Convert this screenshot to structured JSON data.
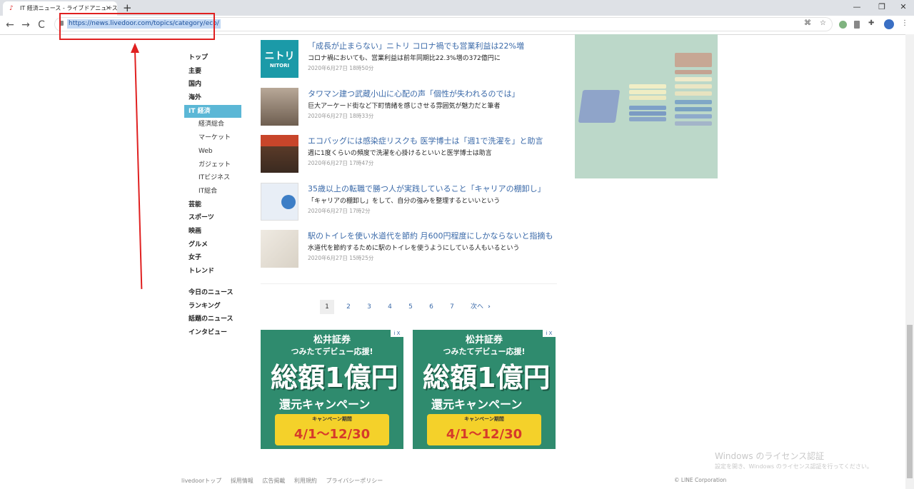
{
  "browser": {
    "tab_title": "IT 経済ニュース - ライブドアニュース",
    "tab_close": "×",
    "new_tab": "+",
    "url": "https://news.livedoor.com/topics/category/eco/",
    "back": "←",
    "forward": "→",
    "reload": "C",
    "menu": "⋮",
    "minimize": "—",
    "maximize": "❐",
    "close": "✕"
  },
  "nav": {
    "items": [
      "トップ",
      "主要",
      "国内",
      "海外"
    ],
    "active": "IT 経済",
    "subitems": [
      "経済総合",
      "マーケット",
      "Web",
      "ガジェット",
      "ITビジネス",
      "IT総合"
    ],
    "items2": [
      "芸能",
      "スポーツ",
      "映画",
      "グルメ",
      "女子",
      "トレンド"
    ],
    "bottom": [
      "今日のニュース",
      "ランキング",
      "話題のニュース",
      "インタビュー"
    ]
  },
  "articles": [
    {
      "title": "「成長が止まらない」ニトリ コロナ禍でも営業利益は22%増",
      "desc": "コロナ禍においても、営業利益は前年同期比22.3%増の372億円に",
      "date": "2020年6月27日 18時50分",
      "thumb_text": "ニトリ",
      "thumb_sub": "NITORI",
      "thumb_color": "#1b9aa8"
    },
    {
      "title": "タワマン建つ武蔵小山に心配の声「個性が失われるのでは」",
      "desc": "巨大アーケード街など下町情緒を感じさせる雰囲気が魅力だと筆者",
      "date": "2020年6月27日 18時33分",
      "thumb_color": "#8a7d6e"
    },
    {
      "title": "エコバッグには感染症リスクも 医学博士は「週1で洗濯を」と助言",
      "desc": "週に1度くらいの頻度で洗濯を心掛けるといいと医学博士は助言",
      "date": "2020年6月27日 17時47分",
      "thumb_color": "#6b3a22"
    },
    {
      "title": "35歳以上の転職で勝つ人が実践していること「キャリアの棚卸し」",
      "desc": "「キャリアの棚卸し」をして、自分の強みを整理するといいという",
      "date": "2020年6月27日 17時2分",
      "thumb_color": "#e8eef6"
    },
    {
      "title": "駅のトイレを使い水道代を節約 月600円程度にしかならないと指摘も",
      "desc": "水道代を節約するために駅のトイレを使うようにしている人もいるという",
      "date": "2020年6月27日 15時25分",
      "thumb_color": "#e9e4dc"
    }
  ],
  "pager": {
    "pages": [
      "1",
      "2",
      "3",
      "4",
      "5",
      "6",
      "7"
    ],
    "next": "次へ",
    "next_icon": "›"
  },
  "ad": {
    "logo": "松井証券",
    "sub": "つみたてデビュー応援!",
    "big": "総額1億円",
    "big2": "還元キャンペーン",
    "campaign": "キャンペーン期間",
    "dates": "4/1〜12/30",
    "adchoice": "i X"
  },
  "footer": {
    "links": [
      "livedoorトップ",
      "採用情報",
      "広告掲載",
      "利用規約",
      "プライバシーポリシー"
    ],
    "copyright": "© LINE Corporation"
  },
  "windows": {
    "watermark_title": "Windows のライセンス認証",
    "watermark_sub": "設定を開き、Windows のライセンス認証を行ってください。"
  },
  "colors": {
    "accent": "#5bb7d6",
    "link": "#3b6aa9",
    "annotation": "#e02020"
  }
}
